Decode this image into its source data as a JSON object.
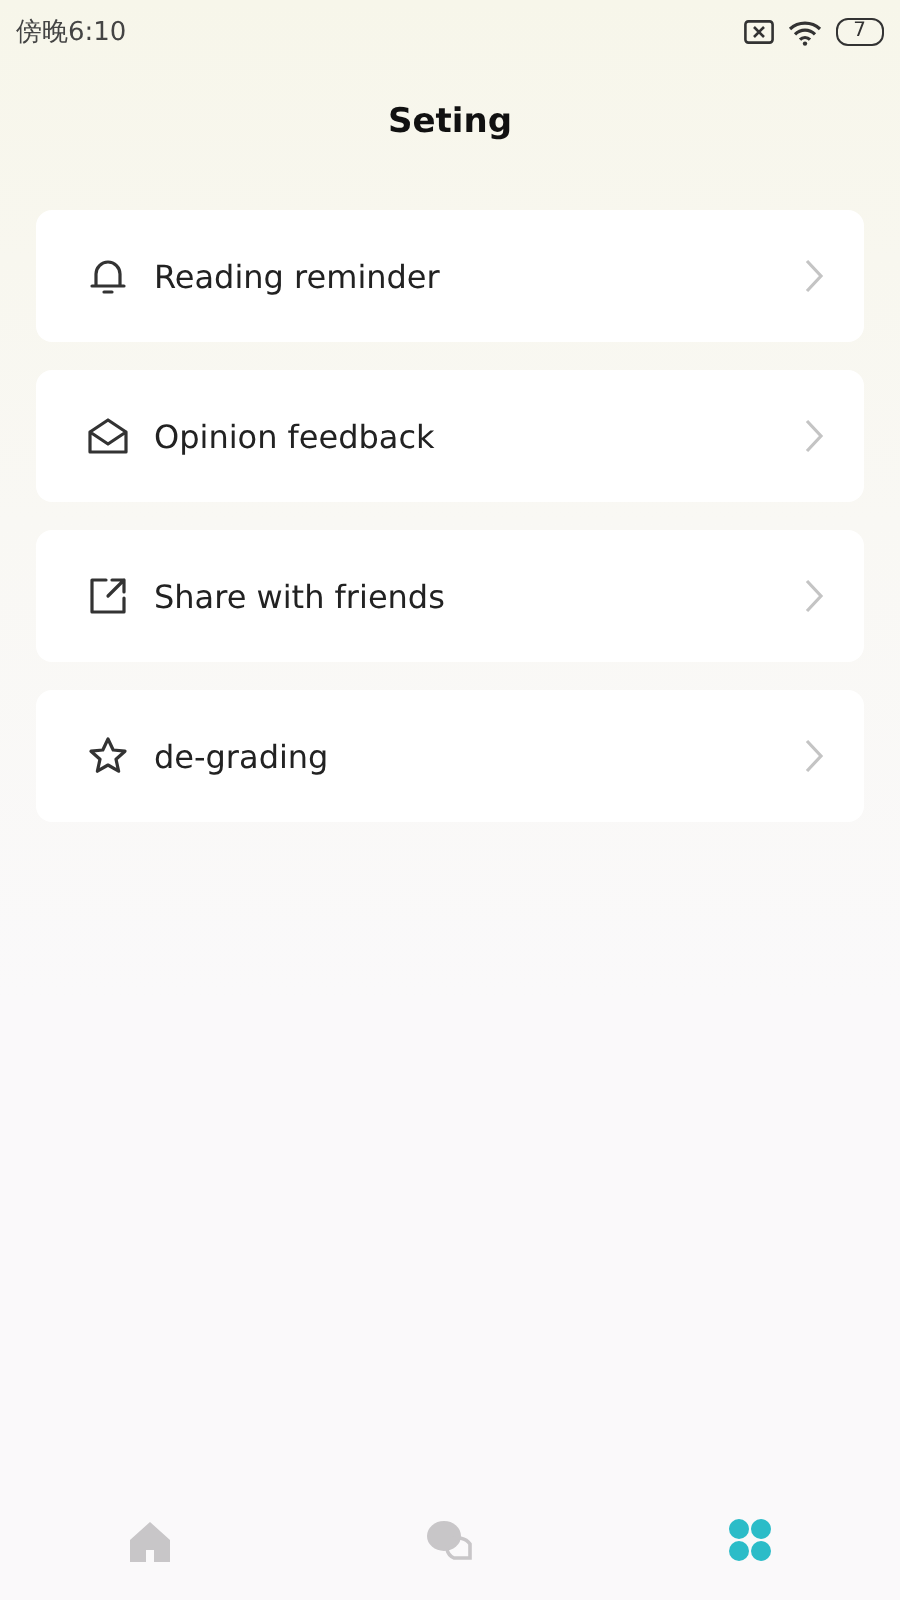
{
  "status_bar": {
    "time": "傍晚6:10",
    "battery": "7"
  },
  "title": "Seting",
  "menu": [
    {
      "kind": "bell",
      "label": "Reading reminder"
    },
    {
      "kind": "mail",
      "label": "Opinion feedback"
    },
    {
      "kind": "share",
      "label": "Share with friends"
    },
    {
      "kind": "star",
      "label": "de-grading"
    }
  ],
  "tabs": [
    {
      "kind": "home",
      "selected": false
    },
    {
      "kind": "chat",
      "selected": false
    },
    {
      "kind": "grid",
      "selected": true
    }
  ]
}
